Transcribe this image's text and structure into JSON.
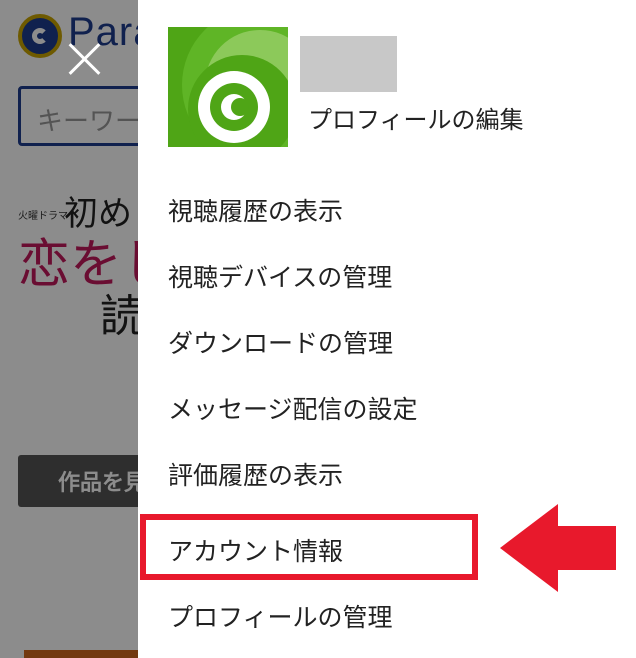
{
  "background": {
    "logo_text": "Para",
    "search_placeholder": "キーワー",
    "banner": {
      "small_text": "火曜ドラマ",
      "line1": "初め",
      "line2": "恋をし",
      "line3": "読"
    },
    "view_button_label": "作品を見"
  },
  "drawer": {
    "profile_edit_label": "プロフィールの編集",
    "menu_items": [
      "視聴履歴の表示",
      "視聴デバイスの管理",
      "ダウンロードの管理",
      "メッセージ配信の設定",
      "評価履歴の表示",
      "アカウント情報",
      "プロフィールの管理"
    ]
  },
  "colors": {
    "accent_green": "#4fa516",
    "highlight_red": "#e8192c",
    "brand_navy": "#1e3c8f"
  },
  "icons": {
    "close": "close-icon",
    "avatar": "paravi-avatar-icon",
    "annotation_arrow": "left-arrow-icon"
  }
}
